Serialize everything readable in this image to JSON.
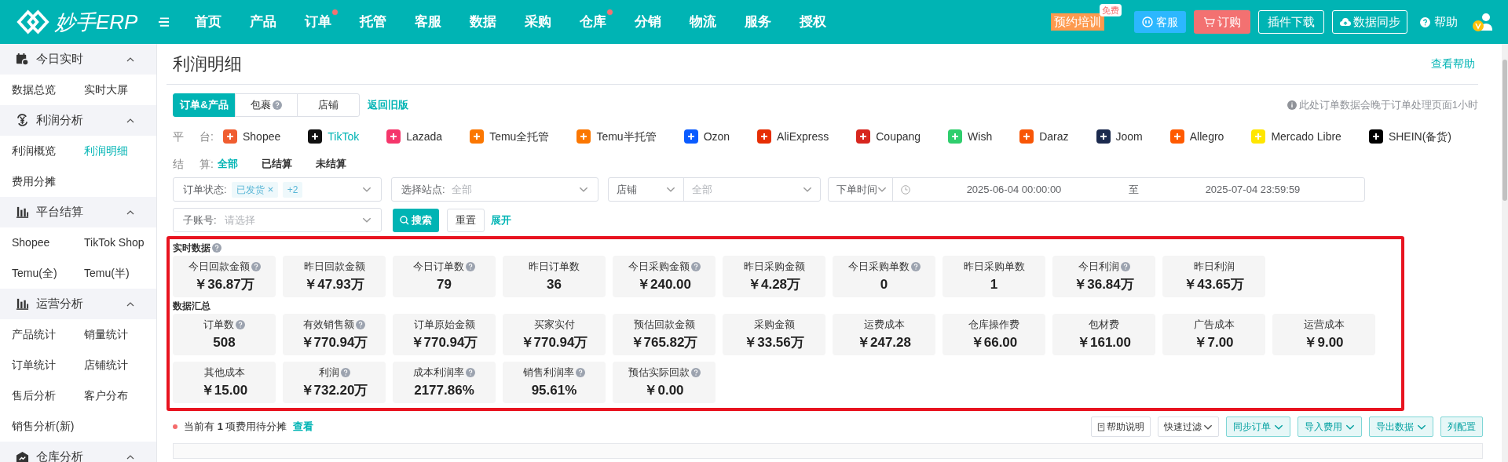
{
  "header": {
    "logo": "妙手ERP",
    "nav": [
      {
        "label": "首页",
        "dot": false
      },
      {
        "label": "产品",
        "dot": false
      },
      {
        "label": "订单",
        "dot": true
      },
      {
        "label": "托管",
        "dot": false
      },
      {
        "label": "客服",
        "dot": false
      },
      {
        "label": "数据",
        "dot": false
      },
      {
        "label": "采购",
        "dot": false
      },
      {
        "label": "仓库",
        "dot": true
      },
      {
        "label": "分销",
        "dot": false
      },
      {
        "label": "物流",
        "dot": false
      },
      {
        "label": "服务",
        "dot": false
      },
      {
        "label": "授权",
        "dot": false
      }
    ],
    "training": {
      "label": "预约培训",
      "badge": "免费"
    },
    "actions": [
      {
        "kind": "service",
        "label": "客服"
      },
      {
        "kind": "order",
        "label": "订购"
      },
      {
        "kind": "outline",
        "label": "插件下载"
      },
      {
        "kind": "sync",
        "label": "数据同步"
      },
      {
        "kind": "help",
        "label": "帮助"
      }
    ]
  },
  "sidebar": {
    "groups": [
      {
        "title": "今日实时",
        "expanded": true,
        "items": [
          {
            "label": "数据总览",
            "selected": false
          },
          {
            "label": "实时大屏",
            "selected": false
          }
        ]
      },
      {
        "title": "利润分析",
        "expanded": true,
        "items": [
          {
            "label": "利润概览",
            "selected": false
          },
          {
            "label": "利润明细",
            "selected": true
          },
          {
            "label": "费用分摊",
            "selected": false
          }
        ]
      },
      {
        "title": "平台结算",
        "expanded": true,
        "items": [
          {
            "label": "Shopee",
            "selected": false
          },
          {
            "label": "TikTok Shop",
            "selected": false
          },
          {
            "label": "Temu(全)",
            "selected": false
          },
          {
            "label": "Temu(半)",
            "selected": false
          }
        ]
      },
      {
        "title": "运营分析",
        "expanded": true,
        "items": [
          {
            "label": "产品统计",
            "selected": false
          },
          {
            "label": "销量统计",
            "selected": false
          },
          {
            "label": "订单统计",
            "selected": false
          },
          {
            "label": "店铺统计",
            "selected": false
          },
          {
            "label": "售后分析",
            "selected": false
          },
          {
            "label": "客户分布",
            "selected": false
          },
          {
            "label": "销售分析(新)",
            "selected": false
          }
        ]
      },
      {
        "title": "仓库分析",
        "expanded": true
      }
    ]
  },
  "page": {
    "title": "利润明细",
    "help_link": "查看帮助",
    "tabs": [
      {
        "label": "订单&产品",
        "selected": true,
        "help": false
      },
      {
        "label": "包裹",
        "selected": false,
        "help": true
      },
      {
        "label": "店铺",
        "selected": false,
        "help": false
      }
    ],
    "back_link": "返回旧版",
    "notice": "此处订单数据会晚于订单处理页面1小时",
    "platform_label": [
      "平",
      "台:"
    ],
    "platforms": [
      {
        "name": "Shopee",
        "color": "#f05d30",
        "selected": false
      },
      {
        "name": "TikTok",
        "color": "#111111",
        "selected": true
      },
      {
        "name": "Lazada",
        "color": "#f5366b",
        "selected": false
      },
      {
        "name": "Temu全托管",
        "color": "#fb7701",
        "selected": false
      },
      {
        "name": "Temu半托管",
        "color": "#fb7701",
        "selected": false
      },
      {
        "name": "Ozon",
        "color": "#0a5bff",
        "selected": false
      },
      {
        "name": "AliExpress",
        "color": "#e62e04",
        "selected": false
      },
      {
        "name": "Coupang",
        "color": "#d7261e",
        "selected": false
      },
      {
        "name": "Wish",
        "color": "#2fce6d",
        "selected": false
      },
      {
        "name": "Daraz",
        "color": "#f85606",
        "selected": false
      },
      {
        "name": "Joom",
        "color": "#1b2a4e",
        "selected": false
      },
      {
        "name": "Allegro",
        "color": "#ff5a00",
        "selected": false
      },
      {
        "name": "Mercado Libre",
        "color": "#ffe600",
        "selected": false
      },
      {
        "name": "SHEIN(备货)",
        "color": "#000000",
        "selected": false
      }
    ],
    "settlement_label": [
      "结",
      "算:"
    ],
    "settlement": [
      {
        "label": "全部",
        "selected": true
      },
      {
        "label": "已结算",
        "selected": false
      },
      {
        "label": "未结算",
        "selected": false
      }
    ],
    "filters": {
      "order_status": {
        "label": "订单状态:",
        "tags": [
          "已发货",
          "+2"
        ]
      },
      "site": {
        "label": "选择站点:",
        "placeholder": "全部"
      },
      "shop": {
        "label": "店铺",
        "placeholder": "全部"
      },
      "time": {
        "label": "下单时间",
        "start": "2025-06-04 00:00:00",
        "separator": "至",
        "end": "2025-07-04 23:59:59"
      },
      "sub_account": {
        "label": "子账号:",
        "placeholder": "请选择"
      }
    },
    "search_button": "搜索",
    "reset_button": "重置",
    "expand_link": "展开",
    "realtime": {
      "title": "实时数据",
      "cards": [
        {
          "label": "今日回款金额",
          "help": true,
          "value": "￥36.87万"
        },
        {
          "label": "昨日回款金额",
          "help": false,
          "value": "￥47.93万"
        },
        {
          "label": "今日订单数",
          "help": true,
          "value": "79"
        },
        {
          "label": "昨日订单数",
          "help": false,
          "value": "36"
        },
        {
          "label": "今日采购金额",
          "help": true,
          "value": "￥240.00"
        },
        {
          "label": "昨日采购金额",
          "help": false,
          "value": "￥4.28万"
        },
        {
          "label": "今日采购单数",
          "help": true,
          "value": "0"
        },
        {
          "label": "昨日采购单数",
          "help": false,
          "value": "1"
        },
        {
          "label": "今日利润",
          "help": true,
          "value": "￥36.84万"
        },
        {
          "label": "昨日利润",
          "help": false,
          "value": "￥43.65万"
        }
      ]
    },
    "summary": {
      "title": "数据汇总",
      "cards": [
        {
          "label": "订单数",
          "help": true,
          "value": "508"
        },
        {
          "label": "有效销售额",
          "help": true,
          "value": "￥770.94万"
        },
        {
          "label": "订单原始金额",
          "help": false,
          "value": "￥770.94万"
        },
        {
          "label": "买家实付",
          "help": false,
          "value": "￥770.94万"
        },
        {
          "label": "预估回款金额",
          "help": false,
          "value": "￥765.82万"
        },
        {
          "label": "采购金额",
          "help": false,
          "value": "￥33.56万"
        },
        {
          "label": "运费成本",
          "help": false,
          "value": "￥247.28"
        },
        {
          "label": "仓库操作费",
          "help": false,
          "value": "￥66.00"
        },
        {
          "label": "包材费",
          "help": false,
          "value": "￥161.00"
        },
        {
          "label": "广告成本",
          "help": false,
          "value": "￥7.00"
        },
        {
          "label": "运营成本",
          "help": false,
          "value": "￥9.00"
        },
        {
          "label": "其他成本",
          "help": false,
          "value": "￥15.00"
        },
        {
          "label": "利润",
          "help": true,
          "value": "￥732.20万"
        },
        {
          "label": "成本利润率",
          "help": true,
          "value": "2177.86%"
        },
        {
          "label": "销售利润率",
          "help": true,
          "value": "95.61%"
        },
        {
          "label": "预估实际回款",
          "help": true,
          "value": "￥0.00"
        }
      ]
    },
    "pending": {
      "text": "当前有 **1** 项费用待分摊",
      "link": "查看"
    },
    "toolbar": [
      {
        "kind": "doc",
        "label": "帮助说明"
      },
      {
        "kind": "plain",
        "label": "快速过滤"
      },
      {
        "kind": "teal",
        "label": "同步订单"
      },
      {
        "kind": "teal",
        "label": "导入费用"
      },
      {
        "kind": "teal",
        "label": "导出数据"
      },
      {
        "kind": "tealplain",
        "label": "列配置"
      }
    ]
  }
}
